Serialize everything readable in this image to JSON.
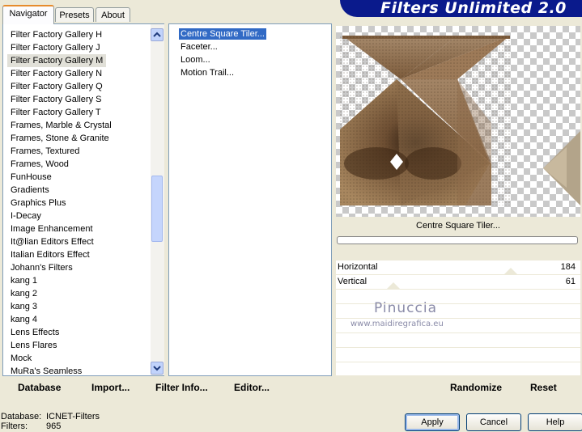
{
  "tabs": [
    {
      "label": "Navigator",
      "active": true
    },
    {
      "label": "Presets",
      "active": false
    },
    {
      "label": "About",
      "active": false
    }
  ],
  "logo": {
    "text": "Filters Unlimited 2.0"
  },
  "categories": [
    "Filter Factory Gallery H",
    "Filter Factory Gallery J",
    "Filter Factory Gallery M",
    "Filter Factory Gallery N",
    "Filter Factory Gallery Q",
    "Filter Factory Gallery S",
    "Filter Factory Gallery T",
    "Frames, Marble & Crystal",
    "Frames, Stone & Granite",
    "Frames, Textured",
    "Frames, Wood",
    "FunHouse",
    "Gradients",
    "Graphics Plus",
    "I-Decay",
    "Image Enhancement",
    "It@lian Editors Effect",
    "Italian Editors Effect",
    "Johann's Filters",
    "kang 1",
    "kang 2",
    "kang 3",
    "kang 4",
    "Lens Effects",
    "Lens Flares",
    "Mock",
    "MuRa's Seamless"
  ],
  "selected_category": "Filter Factory Gallery M",
  "filters": [
    "Centre Square Tiler...",
    "Faceter...",
    "Loom...",
    "Motion Trail..."
  ],
  "selected_filter": "Centre Square Tiler...",
  "filter_name": "Centre Square Tiler...",
  "params": [
    {
      "label": "Horizontal",
      "value": "184"
    },
    {
      "label": "Vertical",
      "value": "61"
    }
  ],
  "watermark": {
    "line1": "Pinuccia",
    "line2": "www.maidiregrafica.eu"
  },
  "commands": {
    "database": "Database",
    "import": "Import...",
    "filter_info": "Filter Info...",
    "editor": "Editor...",
    "randomize": "Randomize",
    "reset": "Reset"
  },
  "info": {
    "database_label": "Database:",
    "database_value": "ICNET-Filters",
    "filters_label": "Filters:",
    "filters_value": "965"
  },
  "buttons": {
    "apply": "Apply",
    "cancel": "Cancel",
    "help": "Help"
  },
  "colors": {
    "selection": "#316ac5",
    "logo_bg": "#0a1a8c",
    "preview_brown": "#8a6a4a"
  }
}
